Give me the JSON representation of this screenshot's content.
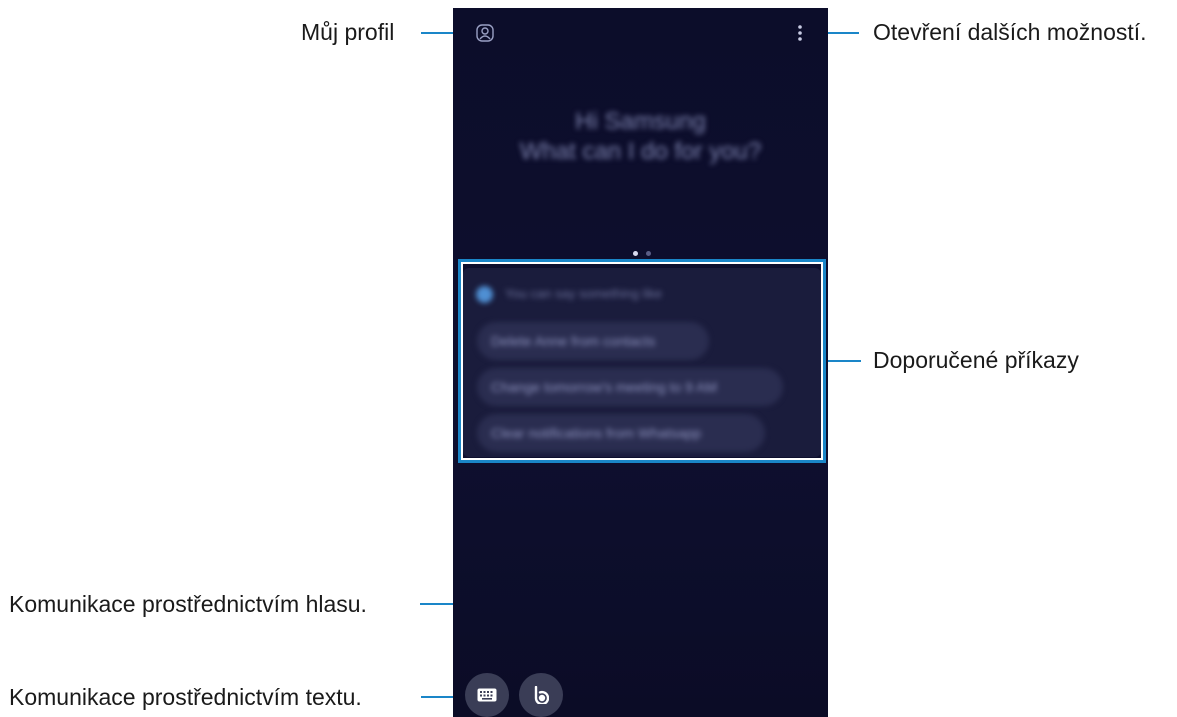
{
  "callouts": {
    "profile": "Můj profil",
    "more_options": "Otevření dalších možností.",
    "suggested": "Doporučené příkazy",
    "voice": "Komunikace prostřednictvím hlasu.",
    "text": "Komunikace prostřednictvím textu."
  },
  "screen": {
    "greeting_line1": "Hi Samsung",
    "greeting_line2": "What can I do for you?",
    "hint": "You can say something like",
    "suggestions": [
      "Delete Anne from contacts",
      "Change tomorrow's meeting to 9 AM",
      "Clear notifications from Whatsapp"
    ]
  },
  "icons": {
    "profile": "profile-icon",
    "more": "more-vertical-icon",
    "keyboard": "keyboard-icon",
    "bixby": "bixby-voice-icon"
  },
  "colors": {
    "accent": "#1a86c8",
    "screen_bg": "#0e0f2f",
    "card_bg": "#1a1c3c",
    "button_bg": "#3a3d56"
  },
  "pager": {
    "pages": 2,
    "active": 1
  }
}
